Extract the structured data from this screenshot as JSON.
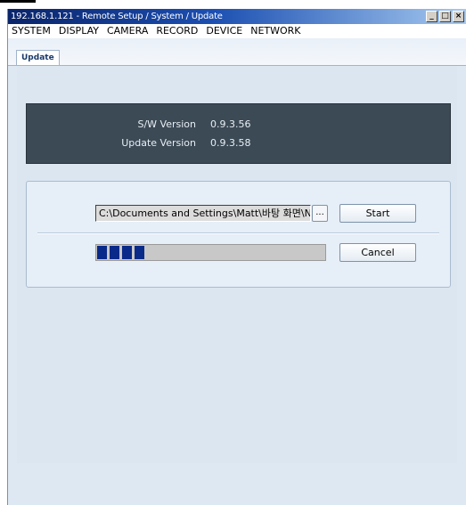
{
  "window": {
    "title": "192.168.1.121 - Remote Setup / System / Update",
    "controls": {
      "minimize": "_",
      "maximize": "□",
      "close": "×"
    }
  },
  "menubar": {
    "items": [
      "SYSTEM",
      "DISPLAY",
      "CAMERA",
      "RECORD",
      "DEVICE",
      "NETWORK"
    ]
  },
  "tabs": [
    {
      "label": "Update",
      "active": true
    }
  ],
  "version_info": {
    "sw_version_label": "S/W Version",
    "sw_version_value": "0.9.3.56",
    "update_version_label": "Update Version",
    "update_version_value": "0.9.3.58"
  },
  "update": {
    "file_path": "C:\\Documents and Settings\\Matt\\바탕 화면\\N",
    "browse_label": "...",
    "start_label": "Start",
    "cancel_label": "Cancel",
    "progress_fraction": 0.22,
    "progress_color": "#0a2a8a"
  },
  "colors": {
    "info_panel_bg": "#3c4a56",
    "content_bg": "#dbe6f1"
  }
}
